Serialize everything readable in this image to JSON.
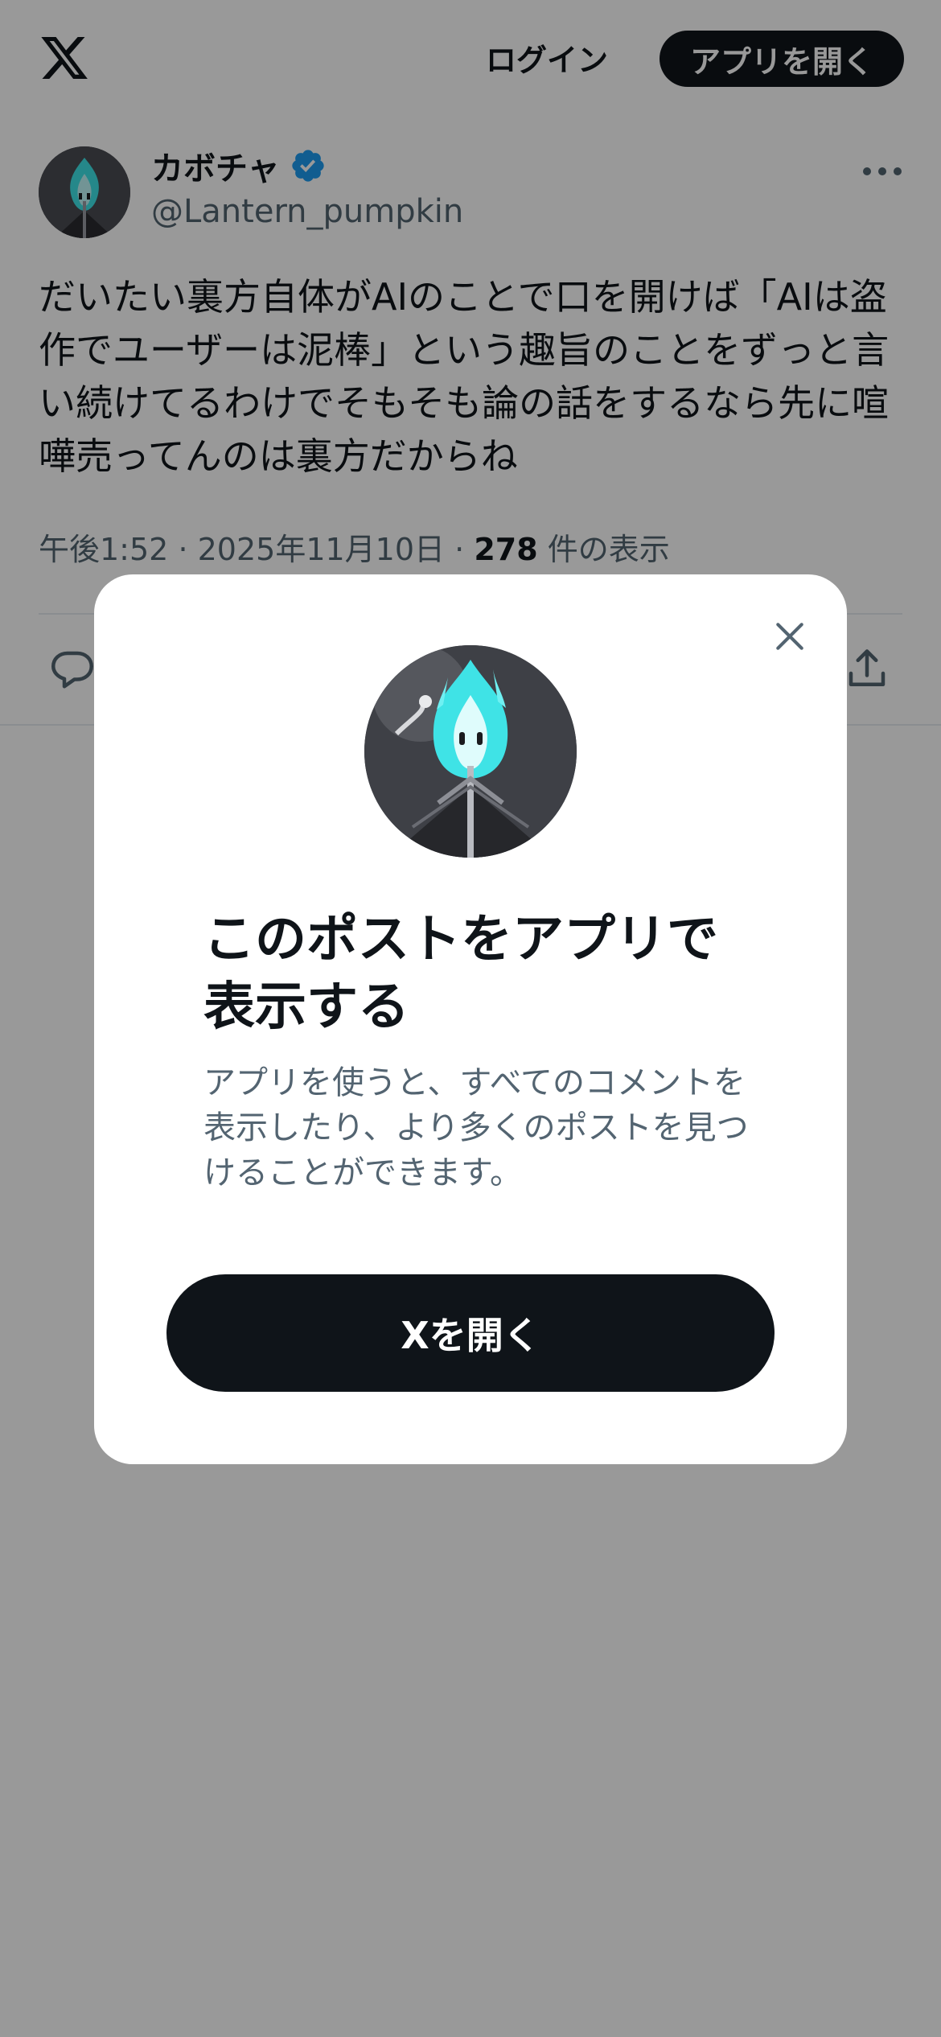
{
  "topbar": {
    "logo_icon": "x-logo-icon",
    "login_label": "ログイン",
    "open_app_label": "アプリを開く"
  },
  "post": {
    "author": {
      "display_name": "カボチャ",
      "handle": "@Lantern_pumpkin",
      "verified": true,
      "verified_color": "#1d9bf0"
    },
    "more_icon": "more-dots-icon",
    "text": "だいたい裏方自体がAIのことで口を開けば「AIは盗作でユーザーは泥棒」という趣旨のことをずっと言い続けてるわけでそもそも論の話をするなら先に喧嘩売ってんのは裏方だからね",
    "time": "午後1:52",
    "separator": "·",
    "date": "2025年11月10日",
    "views_count": "278",
    "views_label": "件の表示",
    "actions": {
      "reply_icon": "reply-icon",
      "share_icon": "share-icon"
    }
  },
  "modal": {
    "close_icon": "close-icon",
    "title": "このポストをアプリで表示する",
    "description": "アプリを使うと、すべてのコメントを表示したり、より多くのポストを見つけることができます。",
    "open_button_label": "Xを開く"
  },
  "colors": {
    "text_primary": "#0f1419",
    "text_secondary": "#536471",
    "button_dark": "#0f1419",
    "overlay": "rgba(0,0,0,0.40)",
    "flame_accent": "#3fe3e6"
  }
}
